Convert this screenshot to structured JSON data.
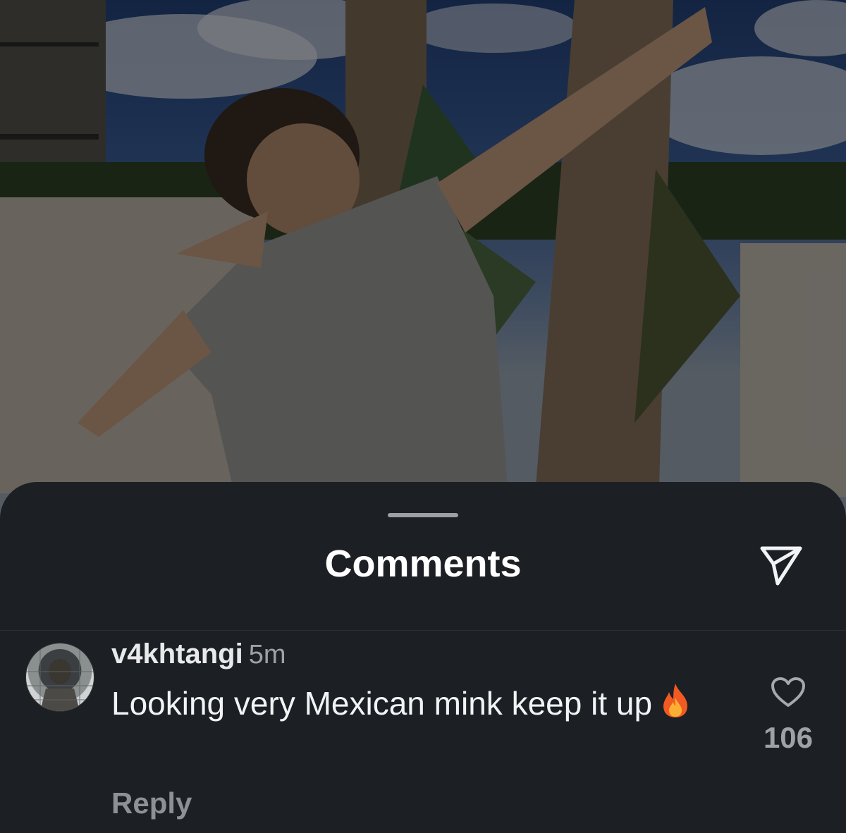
{
  "sheet": {
    "title": "Comments",
    "send_icon": "send-icon"
  },
  "comment": {
    "username": "v4khtangi",
    "time": "5m",
    "text": "Looking very Mexican mink keep it up",
    "emoji_icon": "fire-icon",
    "reply_label": "Reply",
    "like_icon": "heart-icon",
    "like_count": "106"
  },
  "colors": {
    "sheet_bg": "#1c1f23",
    "title": "#ffffff",
    "muted": "#9ea2a8"
  }
}
